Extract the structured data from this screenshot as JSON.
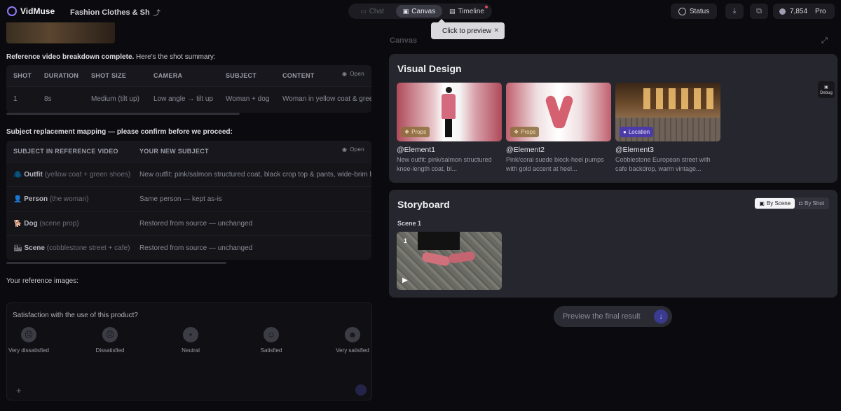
{
  "app": {
    "name": "VidMuse",
    "project_title": "Fashion Clothes & Sh"
  },
  "tabs": [
    {
      "label": "Chat",
      "icon": "chat-icon"
    },
    {
      "label": "Canvas",
      "icon": "canvas-icon"
    },
    {
      "label": "Timeline",
      "icon": "timeline-icon"
    }
  ],
  "tooltip": {
    "text": "Click to preview"
  },
  "header": {
    "status_label": "Status",
    "credits": "7,854",
    "plan": "Pro"
  },
  "left": {
    "breakdown_bold": "Reference video breakdown complete.",
    "breakdown_rest": " Here's the shot summary:",
    "open_label": "Open",
    "shot_table": {
      "headers": [
        "SHOT",
        "DURATION",
        "SHOT SIZE",
        "CAMERA",
        "SUBJECT",
        "CONTENT"
      ],
      "rows": [
        [
          "1",
          "8s",
          "Medium (tilt up)",
          "Low angle → tilt up",
          "Woman + dog",
          "Woman in yellow coat & green"
        ]
      ]
    },
    "mapping_prompt": "Subject replacement mapping — please confirm before we proceed:",
    "mapping_table": {
      "headers": [
        "SUBJECT IN REFERENCE VIDEO",
        "YOUR NEW SUBJECT"
      ],
      "rows": [
        {
          "emoji": "🧥",
          "name": "Outfit",
          "detail": "(yellow coat + green shoes)",
          "new": "New outfit: pink/salmon structured coat, black crop top & pants, wide-brim b"
        },
        {
          "emoji": "👤",
          "name": "Person",
          "detail": "(the woman)",
          "new": "Same person — kept as-is"
        },
        {
          "emoji": "🐕",
          "name": "Dog",
          "detail": "(scene prop)",
          "new": "Restored from source — unchanged"
        },
        {
          "emoji": "🏙",
          "name": "Scene",
          "detail": "(cobblestone street + cafe)",
          "new": "Restored from source — unchanged"
        }
      ]
    },
    "ref_images_label": "Your reference images:",
    "survey": {
      "question": "Satisfaction with the use of this product?",
      "options": [
        "Very dissatisfied",
        "Dissatisfied",
        "Neutral",
        "Satisfied",
        "Very satisfied"
      ]
    }
  },
  "right": {
    "canvas_label": "Canvas",
    "visual_design": {
      "title": "Visual Design",
      "items": [
        {
          "name": "@Element1",
          "tag": "Props",
          "desc": "New outfit: pink/salmon structured knee-length coat, bl..."
        },
        {
          "name": "@Element2",
          "tag": "Props",
          "desc": "Pink/coral suede block-heel pumps with gold accent at heel..."
        },
        {
          "name": "@Element3",
          "tag": "Location",
          "desc": "Cobblestone European street with cafe backdrop, warm vintage..."
        }
      ]
    },
    "debug_label": "Debug",
    "storyboard": {
      "title": "Storyboard",
      "by_scene": "By Scene",
      "by_shot": "By Shot",
      "scene_label": "Scene 1",
      "shot_number": "1"
    },
    "preview_button": "Preview the final result"
  },
  "colors": {
    "accent": "#8f7cf5",
    "tag_location": "#4b3ba8",
    "status_dot": "#e04b55"
  }
}
